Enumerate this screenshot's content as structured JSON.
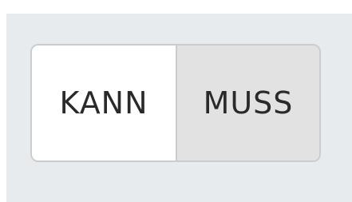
{
  "toggle": {
    "options": [
      {
        "label": "KANN",
        "selected": true
      },
      {
        "label": "MUSS",
        "selected": false
      }
    ]
  }
}
